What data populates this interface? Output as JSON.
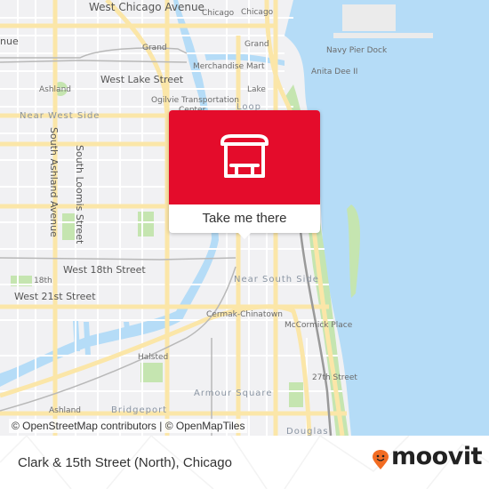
{
  "popup": {
    "icon": "bus-stop-shelter-icon",
    "action_label": "Take me there",
    "color": "#e40c2b"
  },
  "map": {
    "attribution": "© OpenStreetMap contributors | © OpenMapTiles",
    "labels": {
      "west_chicago_avenue": "West Chicago Avenue",
      "chicago_1": "Chicago",
      "chicago_2": "Chicago",
      "avenue_partial": "nue",
      "grand_1": "Grand",
      "grand_2": "Grand",
      "navy_pier_dock": "Navy Pier Dock",
      "merchandise_mart": "Merchandise Mart",
      "anita_dee": "Anita Dee II",
      "ashland_1": "Ashland",
      "west_lake_street": "West Lake Street",
      "lake": "Lake",
      "ogilvie": "Ogilvie Transportation",
      "center": "Center",
      "loop": "Loop",
      "near_west_side": "Near West Side",
      "south_ashland_avenue": "South Ashland Avenue",
      "south_loomis_street": "South Loomis Street",
      "west_18th_street": "West 18th Street",
      "s18th": "18th",
      "west_21st_street": "West 21st Street",
      "near_south_side": "Near South Side",
      "cermak_chinatown": "Cermak-Chinatown",
      "mccormick_place": "McCormick Place",
      "halsted": "Halsted",
      "s27th_street": "27th Street",
      "armour_square": "Armour Square",
      "ashland_2": "Ashland",
      "bridgeport": "Bridgeport",
      "douglas": "Douglas"
    },
    "colors": {
      "water": "#b5dcf7",
      "park": "#c5e5b0",
      "road": "#fbe6a8",
      "land": "#f1f1f3"
    }
  },
  "footer": {
    "stop_title": "Clark & 15th Street (North), Chicago",
    "brand": "moovit",
    "brand_color": "#f26c22"
  }
}
